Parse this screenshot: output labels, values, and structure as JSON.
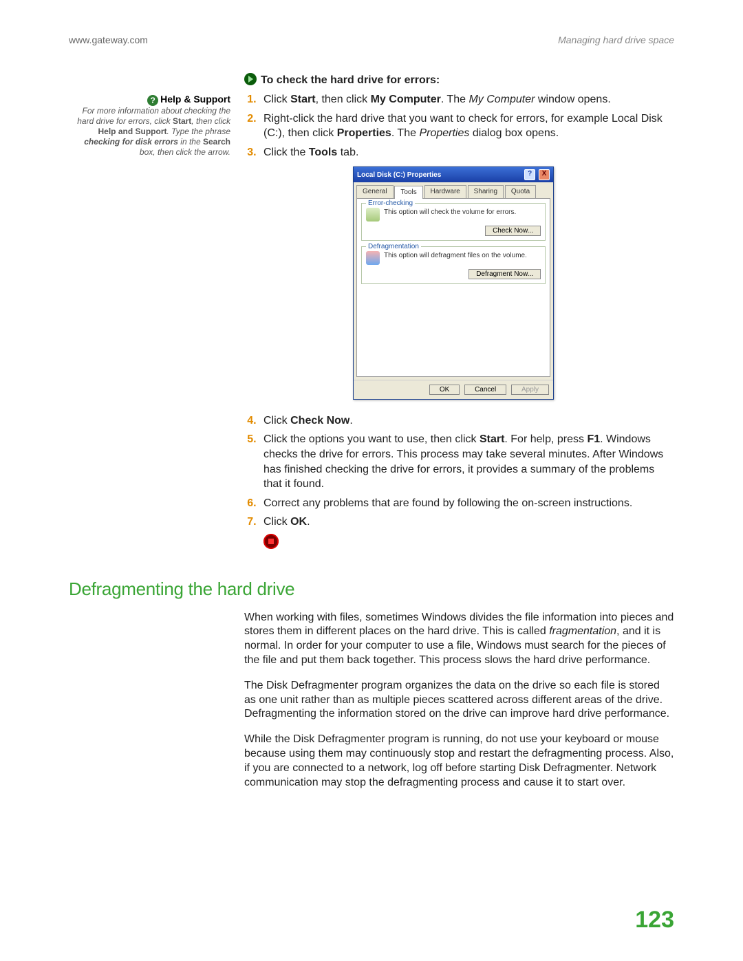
{
  "header": {
    "left": "www.gateway.com",
    "right": "Managing hard drive space"
  },
  "sidebar": {
    "title": "Help & Support",
    "text_a": "For more information about checking the hard drive for errors, click ",
    "bold_a": "Start",
    "text_b": ", then click ",
    "bold_b": "Help and Support",
    "text_c": ". Type the phrase ",
    "key": "checking for disk errors",
    "text_d": " in the ",
    "bold_c": "Search",
    "text_e": " box, then click the arrow."
  },
  "task": {
    "title": "To check the hard drive for errors:",
    "steps": {
      "s1_a": "Click ",
      "s1_b1": "Start",
      "s1_c": ", then click ",
      "s1_b2": "My Computer",
      "s1_d": ". The ",
      "s1_i": "My Computer",
      "s1_e": " window opens.",
      "s2_a": "Right-click the hard drive that you want to check for errors, for example Local Disk (C:), then click ",
      "s2_b": "Properties",
      "s2_c": ". The ",
      "s2_i": "Properties",
      "s2_d": " dialog box opens.",
      "s3_a": "Click the ",
      "s3_b": "Tools",
      "s3_c": " tab.",
      "s4_a": "Click ",
      "s4_b": "Check Now",
      "s4_c": ".",
      "s5_a": "Click the options you want to use, then click ",
      "s5_b": "Start",
      "s5_c": ". For help, press ",
      "s5_b2": "F1",
      "s5_d": ". Windows checks the drive for errors. This process may take several minutes. After Windows has finished checking the drive for errors, it provides a summary of the problems that it found.",
      "s6": "Correct any problems that are found by following the on-screen instructions.",
      "s7_a": "Click ",
      "s7_b": "OK",
      "s7_c": "."
    }
  },
  "dialog": {
    "title": "Local Disk (C:) Properties",
    "tabs": [
      "General",
      "Tools",
      "Hardware",
      "Sharing",
      "Quota"
    ],
    "group1": {
      "legend": "Error-checking",
      "text": "This option will check the volume for errors.",
      "btn": "Check Now..."
    },
    "group2": {
      "legend": "Defragmentation",
      "text": "This option will defragment files on the volume.",
      "btn": "Defragment Now..."
    },
    "ok": "OK",
    "cancel": "Cancel",
    "apply": "Apply"
  },
  "section": {
    "heading": "Defragmenting the hard drive",
    "p1_a": "When working with files, sometimes Windows divides the file information into pieces and stores them in different places on the hard drive. This is called ",
    "p1_i": "fragmentation",
    "p1_b": ", and it is normal. In order for your computer to use a file, Windows must search for the pieces of the file and put them back together. This process slows the hard drive performance.",
    "p2": "The Disk Defragmenter program organizes the data on the drive so each file is stored as one unit rather than as multiple pieces scattered across different areas of the drive. Defragmenting the information stored on the drive can improve hard drive performance.",
    "p3": "While the Disk Defragmenter program is running, do not use your keyboard or mouse because using them may continuously stop and restart the defragmenting process. Also, if you are connected to a network, log off before starting Disk Defragmenter. Network communication may stop the defragmenting process and cause it to start over."
  },
  "page_number": "123"
}
